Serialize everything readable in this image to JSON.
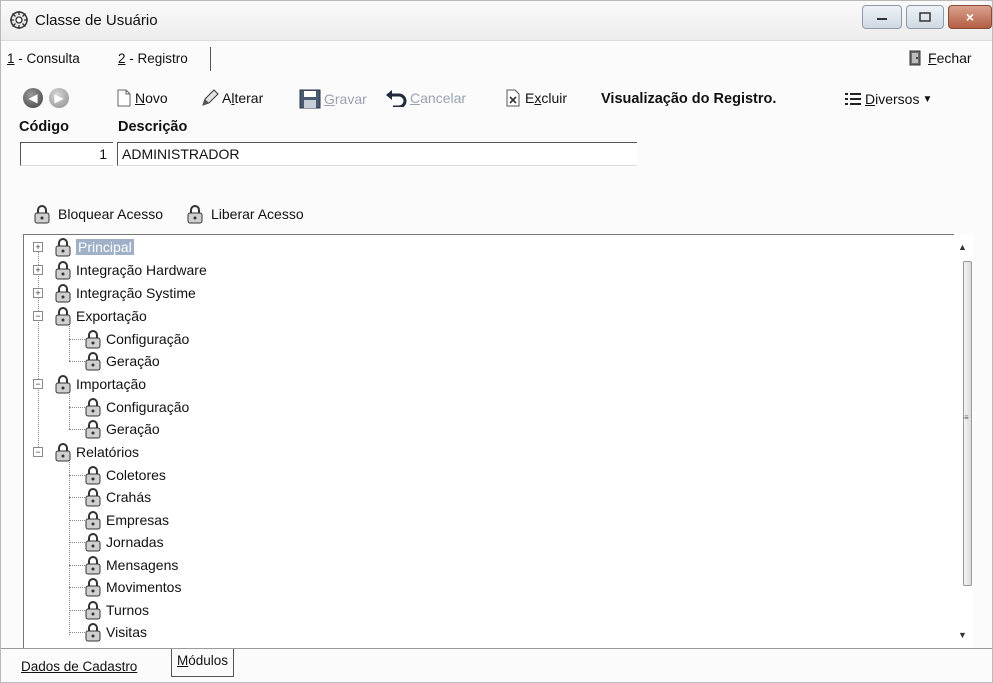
{
  "window": {
    "title": "Classe de Usuário",
    "minimize_icon": "minimize-icon",
    "maximize_icon": "maximize-icon",
    "close_label": "×"
  },
  "top_tabs": [
    {
      "key": "1",
      "label": " - Consulta"
    },
    {
      "key": "2",
      "label": " - Registro"
    }
  ],
  "fechar": {
    "key": "F",
    "rest": "echar"
  },
  "toolbar": {
    "novo_key": "N",
    "novo_rest": "ovo",
    "alterar_pre": "A",
    "alterar_key": "l",
    "alterar_rest": "terar",
    "gravar_key": "G",
    "gravar_rest": "ravar",
    "cancelar_key": "C",
    "cancelar_rest": "ancelar",
    "excluir_pre": "E",
    "excluir_key": "x",
    "excluir_rest": "cluir",
    "visualizacao": "Visualização do Registro.",
    "diversos_key": "D",
    "diversos_rest": "iversos"
  },
  "fields": {
    "codigo_label": "Código",
    "descricao_label": "Descrição",
    "codigo_value": "1",
    "descricao_value": "ADMINISTRADOR"
  },
  "access": {
    "bloquear": "Bloquear Acesso",
    "liberar": "Liberar Acesso"
  },
  "tree": {
    "principal": "Principal",
    "integracao_hardware": "Integração Hardware",
    "integracao_systime": "Integração Systime",
    "exportacao": "Exportação",
    "exp_config": "Configuração",
    "exp_geracao": "Geração",
    "importacao": "Importação",
    "imp_config": "Configuração",
    "imp_geracao": "Geração",
    "relatorios": "Relatórios",
    "coletores": "Coletores",
    "crahas": "Crahás",
    "empresas": "Empresas",
    "jornadas": "Jornadas",
    "mensagens": "Mensagens",
    "movimentos": "Movimentos",
    "turnos": "Turnos",
    "visitas": "Visitas"
  },
  "bottom_tabs": {
    "dados_key": "D",
    "dados_rest": "ados de Cadastro",
    "modulos_key": "M",
    "modulos_rest": "ódulos"
  }
}
